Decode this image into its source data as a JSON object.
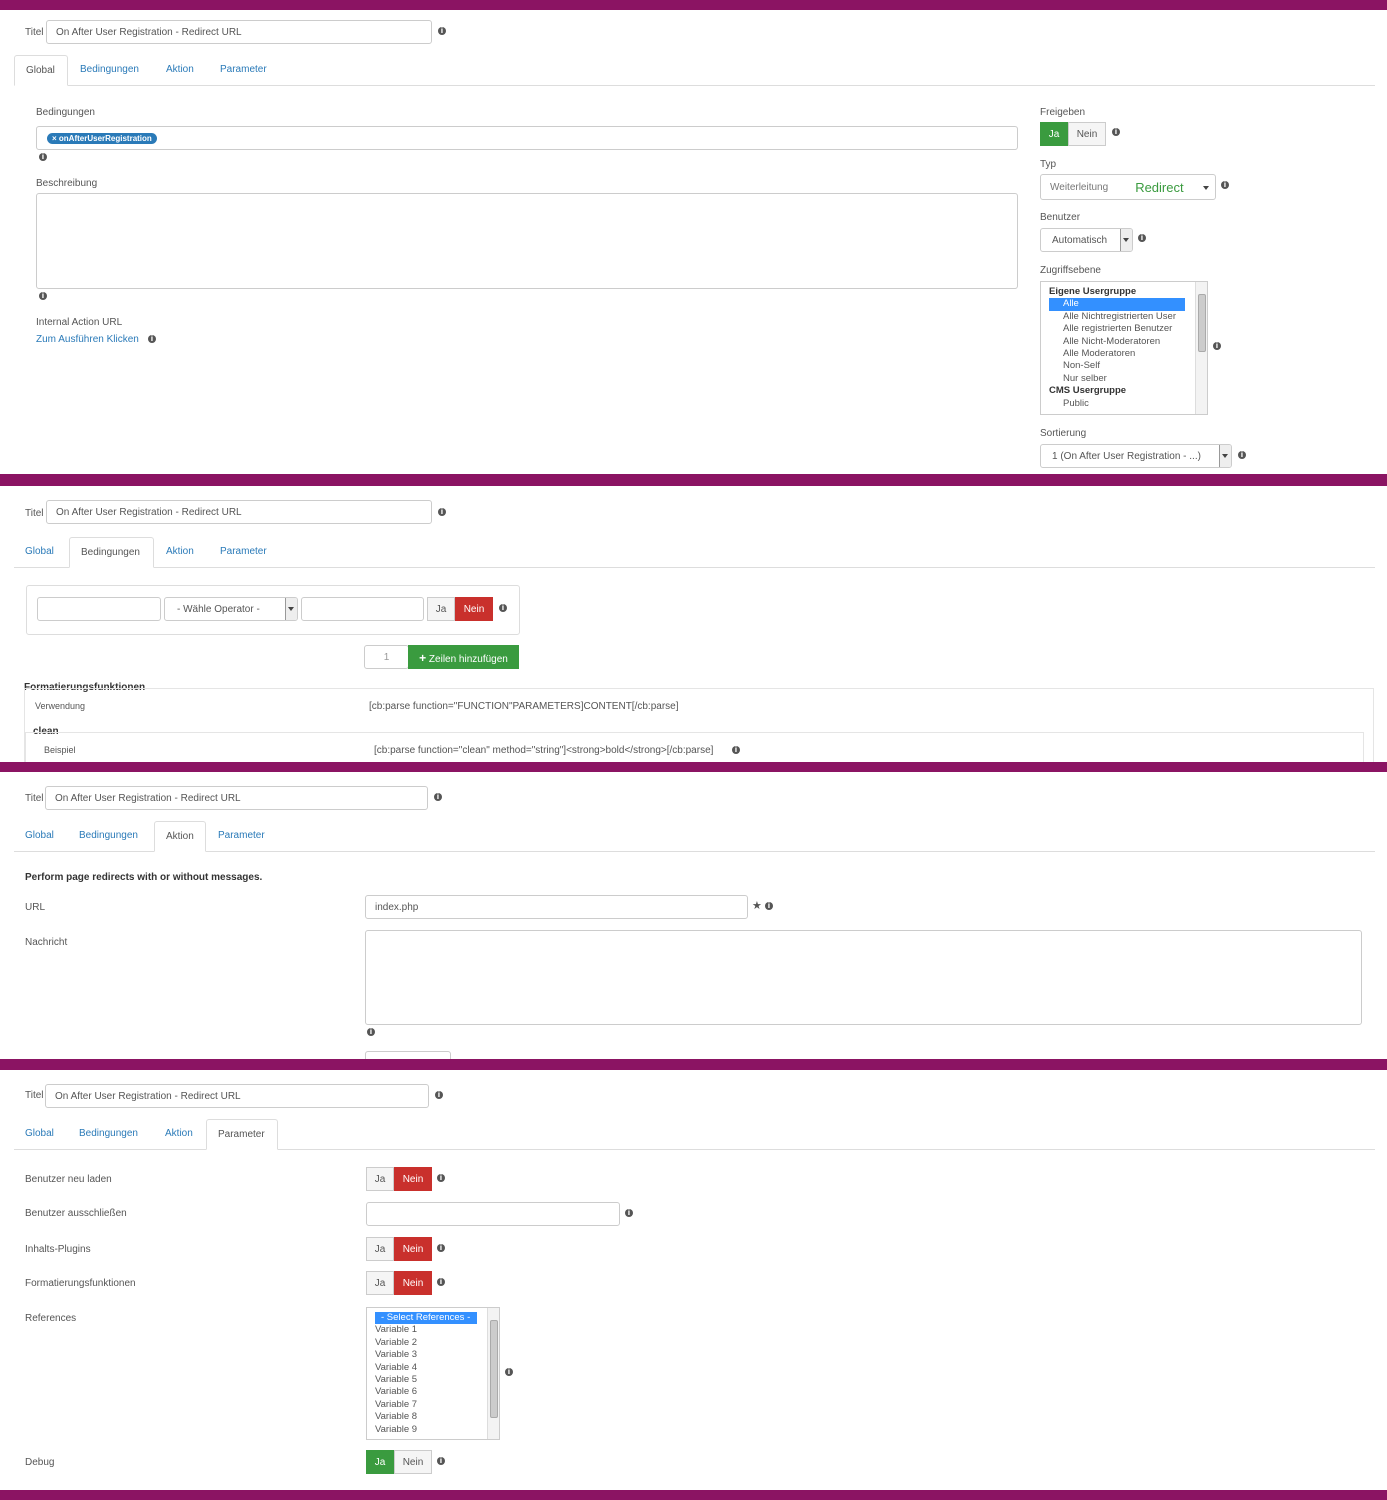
{
  "colors": {
    "frame": "#8b1463",
    "accent_green": "#3a9b3f",
    "accent_red": "#c9302c",
    "link": "#2a7ab8"
  },
  "common": {
    "title_label": "Titel",
    "title_value": "On After User Registration -  Redirect URL",
    "tabs": [
      "Global",
      "Bedingungen",
      "Aktion",
      "Parameter"
    ],
    "yes": "Ja",
    "no": "Nein",
    "info_icon": "info-circle-icon"
  },
  "global": {
    "conditions_label": "Bedingungen",
    "condition_tag": "× onAfterUserRegistration",
    "description_label": "Beschreibung",
    "description_value": "",
    "internal_url_label": "Internal Action URL",
    "internal_url_link": "Zum Ausführen Klicken",
    "publish_label": "Freigeben",
    "type_label": "Typ",
    "type_group": "Weiterleitung",
    "type_value": "Redirect",
    "user_label": "Benutzer",
    "user_value": "Automatisch",
    "access_label": "Zugriffsebene",
    "access_options": [
      {
        "text": "Eigene Usergruppe",
        "group": true
      },
      {
        "text": "Alle",
        "selected": true
      },
      {
        "text": "Alle Nichtregistrierten User"
      },
      {
        "text": "Alle registrierten Benutzer"
      },
      {
        "text": "Alle Nicht-Moderatoren"
      },
      {
        "text": "Alle Moderatoren"
      },
      {
        "text": "Non-Self"
      },
      {
        "text": "Nur selber"
      },
      {
        "text": "CMS Usergruppe",
        "group": true
      },
      {
        "text": "Public"
      }
    ],
    "ordering_label": "Sortierung",
    "ordering_value": "1 (On After User Registration - ...)"
  },
  "conditions": {
    "field_value": "",
    "operator_placeholder": "- Wähle Operator -",
    "value_value": "",
    "rows_count": "1",
    "add_rows_label": "Zeilen hinzufügen",
    "formatting_title": "Formatierungsfunktionen",
    "usage_label": "Verwendung",
    "usage_value": "[cb:parse function=\"FUNCTION\"PARAMETERS]CONTENT[/cb:parse]",
    "clean_title": "clean",
    "example_label": "Beispiel",
    "example_value": "[cb:parse function=\"clean\" method=\"string\"]<strong>bold</strong>[/cb:parse]"
  },
  "action": {
    "heading": "Perform page redirects with or without messages.",
    "url_label": "URL",
    "url_value": "index.php",
    "message_label": "Nachricht",
    "message_value": ""
  },
  "parameters": {
    "reload_label": "Benutzer neu laden",
    "exclude_label": "Benutzer ausschließen",
    "exclude_value": "",
    "content_plugins_label": "Inhalts-Plugins",
    "formatting_label": "Formatierungsfunktionen",
    "references_label": "References",
    "references_options": [
      "- Select References -",
      "Variable 1",
      "Variable 2",
      "Variable 3",
      "Variable 4",
      "Variable 5",
      "Variable 6",
      "Variable 7",
      "Variable 8",
      "Variable 9"
    ],
    "debug_label": "Debug"
  }
}
